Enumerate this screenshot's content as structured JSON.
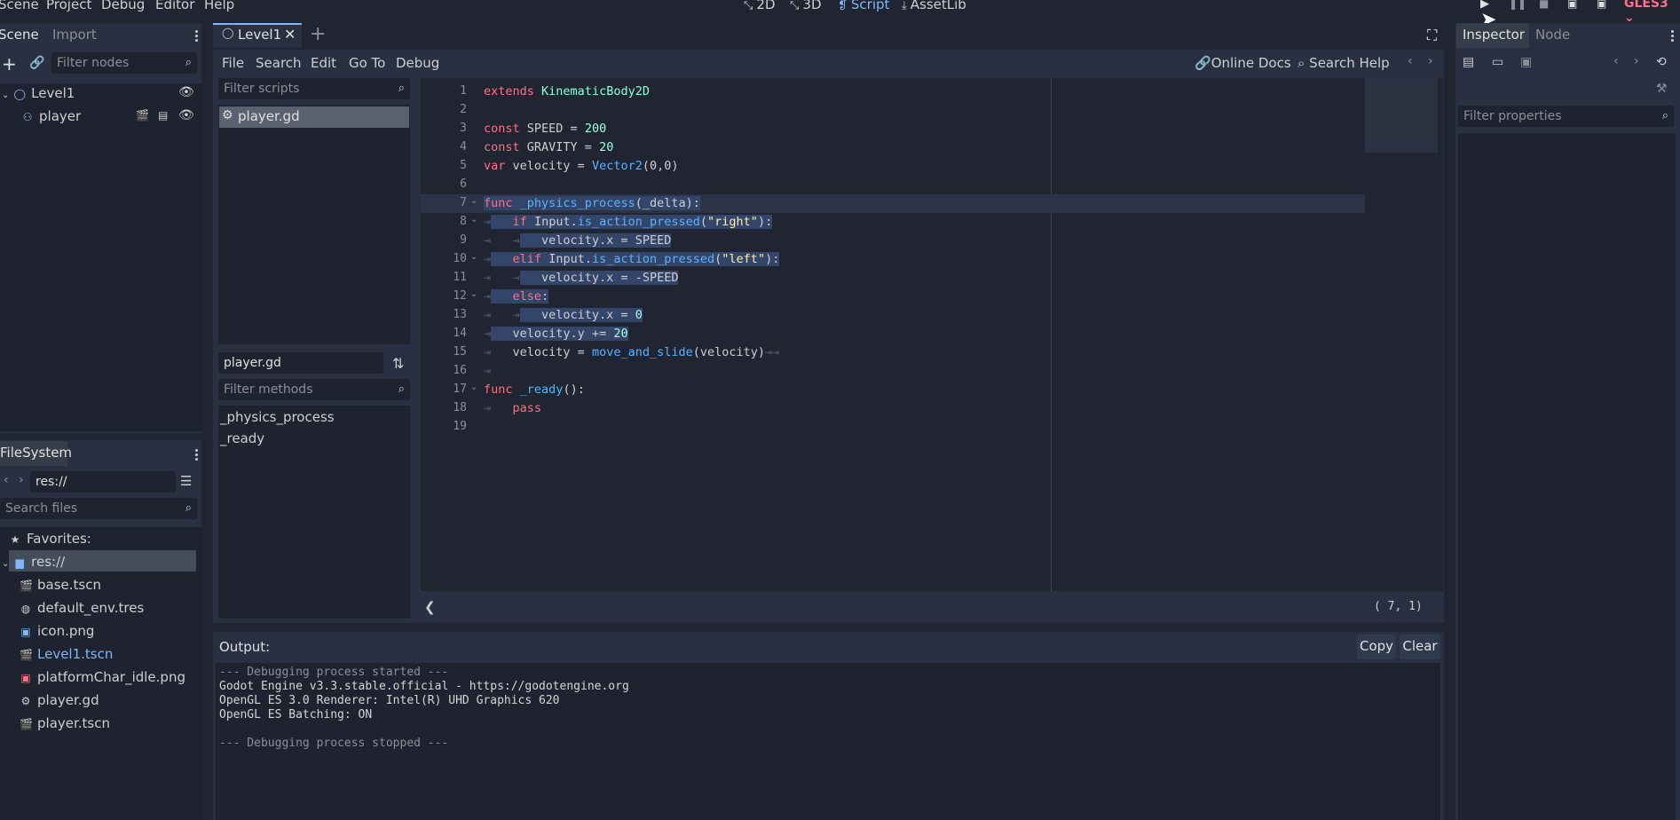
{
  "menu": [
    "Scene",
    "Project",
    "Debug",
    "Editor",
    "Help"
  ],
  "workspaces": [
    {
      "label": "2D",
      "icon": "2d-icon",
      "active": false
    },
    {
      "label": "3D",
      "icon": "3d-icon",
      "active": false
    },
    {
      "label": "Script",
      "icon": "script-icon",
      "active": true
    },
    {
      "label": "AssetLib",
      "icon": "assetlib-icon",
      "active": false
    }
  ],
  "renderer": "GLES3",
  "scene_dock": {
    "tabs": [
      "Scene",
      "Import"
    ],
    "filter_placeholder": "Filter nodes",
    "nodes": [
      {
        "name": "Level1",
        "icon": "node2d-icon"
      },
      {
        "name": "player",
        "icon": "kinematicbody-icon"
      }
    ]
  },
  "filesystem_dock": {
    "title": "FileSystem",
    "path": "res://",
    "search_placeholder": "Search files",
    "favorites_label": "Favorites:",
    "root": "res://",
    "files": [
      {
        "name": "base.tscn",
        "icon": "scene-icon"
      },
      {
        "name": "default_env.tres",
        "icon": "environment-icon"
      },
      {
        "name": "icon.png",
        "icon": "image-icon"
      },
      {
        "name": "Level1.tscn",
        "icon": "scene-icon",
        "highlight": true
      },
      {
        "name": "platformChar_idle.png",
        "icon": "image-icon"
      },
      {
        "name": "player.gd",
        "icon": "gear-icon"
      },
      {
        "name": "player.tscn",
        "icon": "scene-icon"
      }
    ]
  },
  "scene_tab": {
    "label": "Level1"
  },
  "script_menu": [
    "File",
    "Search",
    "Edit",
    "Go To",
    "Debug"
  ],
  "script_toolbar": {
    "online_docs": "Online Docs",
    "search_help": "Search Help"
  },
  "script_list": {
    "filter_placeholder": "Filter scripts",
    "items": [
      "player.gd"
    ],
    "current": "player.gd",
    "methods_placeholder": "Filter methods",
    "methods": [
      "_physics_process",
      "_ready"
    ]
  },
  "code_lines": [
    "1",
    "2",
    "3",
    "4",
    "5",
    "6",
    "7",
    "8",
    "9",
    "10",
    "11",
    "12",
    "13",
    "14",
    "15",
    "16",
    "17",
    "18",
    "19"
  ],
  "code": {
    "l1_kw": "extends",
    "l1_cls": "KinematicBody2D",
    "l3_kw": "const",
    "l3_name": "SPEED =",
    "l3_num": "200",
    "l4_kw": "const",
    "l4_name": "GRAVITY =",
    "l4_num": "20",
    "l5_kw": "var",
    "l5_name": "velocity =",
    "l5_cls": "Vector2",
    "l5_args": "(0,0)",
    "l7_kw": "func",
    "l7_fn": "_physics_process",
    "l7_rest": "(_delta):",
    "l8_kw": "if",
    "l8_obj": "Input",
    "l8_fn": "is_action_pressed",
    "l8_p1": "(",
    "l8_str": "\"right\"",
    "l8_p2": "):",
    "l9": "velocity.x = SPEED",
    "l10_kw": "elif",
    "l10_obj": "Input",
    "l10_fn": "is_action_pressed",
    "l10_p1": "(",
    "l10_str": "\"left\"",
    "l10_p2": "):",
    "l11": "velocity.x = -SPEED",
    "l12_kw": "else",
    "l12_rest": ":",
    "l13": "velocity.x =",
    "l13_num": "0",
    "l14": "velocity.y +=",
    "l14_num": "20",
    "l15_a": "velocity =",
    "l15_fn": "move_and_slide",
    "l15_b": "(velocity)",
    "l17_kw": "func",
    "l17_fn": "_ready",
    "l17_rest": "():",
    "l18_kw": "pass"
  },
  "status": {
    "line": "7",
    "col": "1"
  },
  "output": {
    "title": "Output:",
    "copy": "Copy",
    "clear": "Clear",
    "lines": [
      "--- Debugging process started ---",
      "Godot Engine v3.3.stable.official - https://godotengine.org",
      "OpenGL ES 3.0 Renderer: Intel(R) UHD Graphics 620",
      "OpenGL ES Batching: ON",
      "",
      "--- Debugging process stopped ---"
    ]
  },
  "inspector": {
    "tabs": [
      "Inspector",
      "Node"
    ],
    "filter_placeholder": "Filter properties"
  },
  "colors": {
    "accent": "#7fb6f5",
    "background": "#202531",
    "panel": "#283041",
    "keyword": "#ff7085"
  }
}
